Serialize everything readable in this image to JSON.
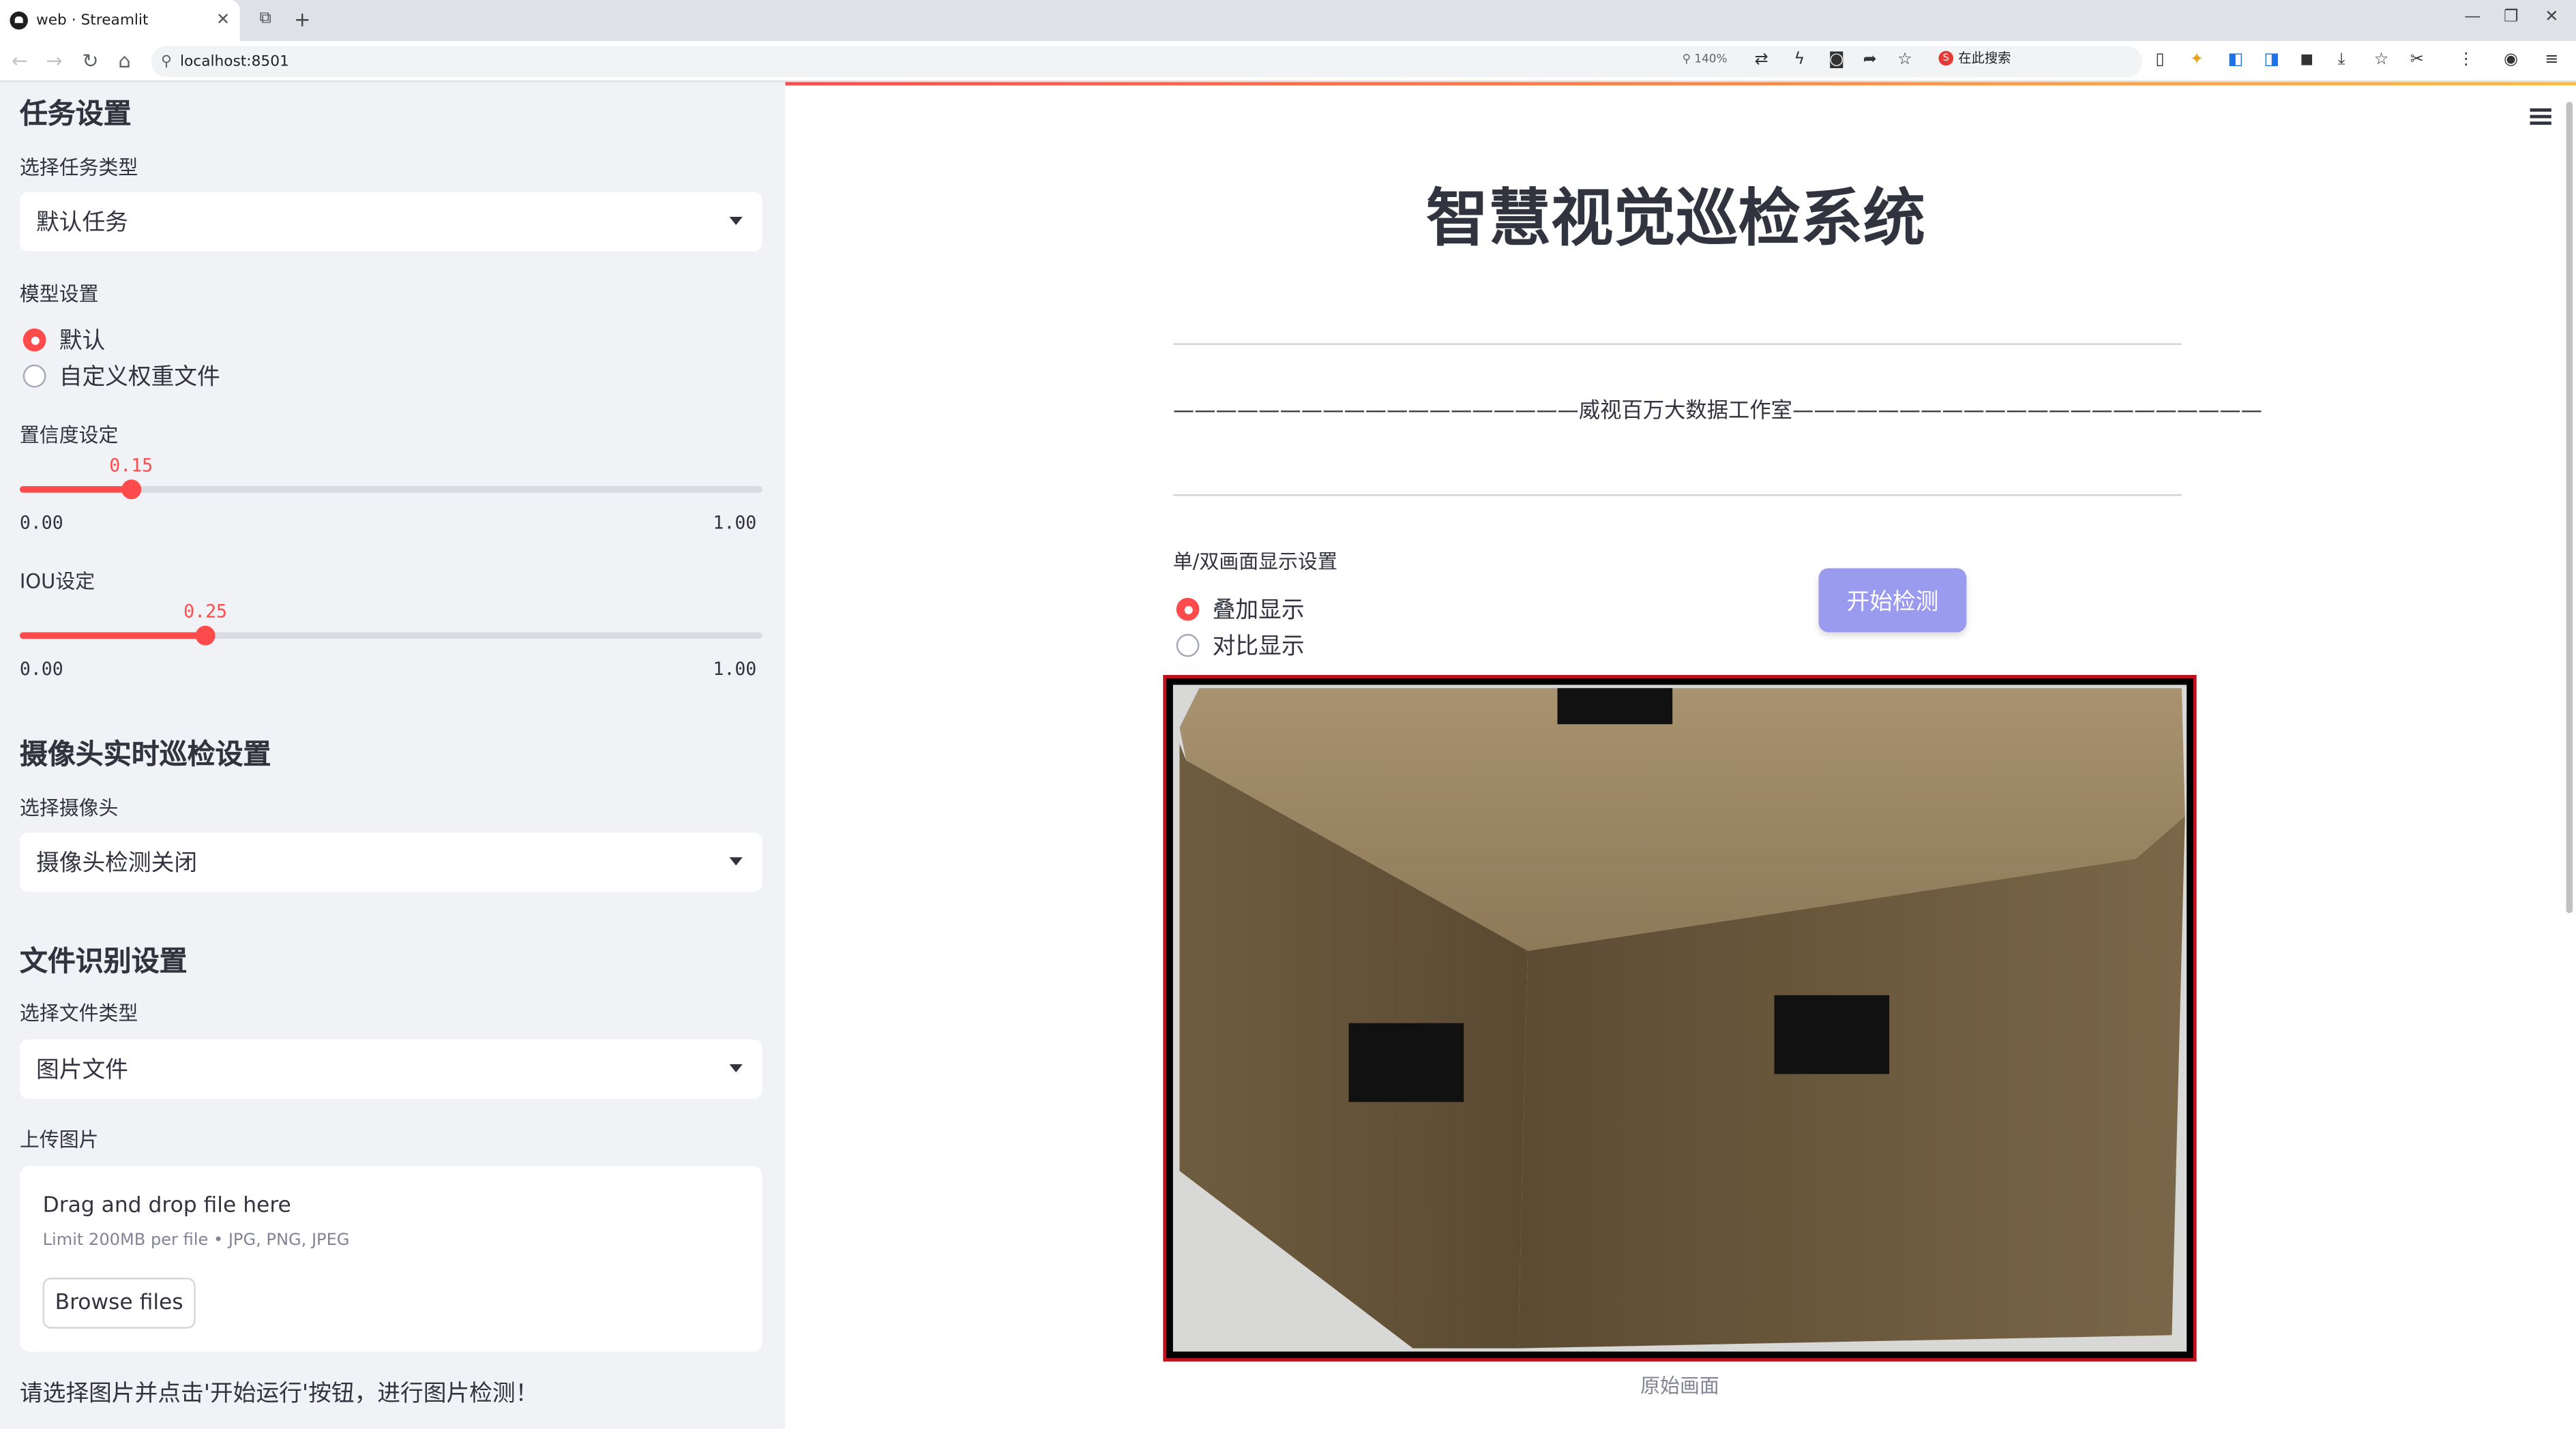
{
  "browser": {
    "tab_title": "web · Streamlit",
    "url": "localhost:8501",
    "zoom": "140%",
    "search_chip": "在此搜索"
  },
  "sidebar": {
    "task_section": {
      "heading": "任务设置",
      "select_label": "选择任务类型",
      "select_value": "默认任务"
    },
    "model": {
      "label": "模型设置",
      "options": [
        "默认",
        "自定义权重文件"
      ],
      "selected": "默认"
    },
    "confidence": {
      "label": "置信度设定",
      "value": "0.15",
      "fraction": 0.15,
      "min": "0.00",
      "max": "1.00"
    },
    "iou": {
      "label": "IOU设定",
      "value": "0.25",
      "fraction": 0.25,
      "min": "0.00",
      "max": "1.00"
    },
    "camera_section": {
      "heading": "摄像头实时巡检设置",
      "select_label": "选择摄像头",
      "select_value": "摄像头检测关闭"
    },
    "file_section": {
      "heading": "文件识别设置",
      "select_label": "选择文件类型",
      "select_value": "图片文件",
      "upload_label": "上传图片"
    },
    "uploader": {
      "title": "Drag and drop file here",
      "limit": "Limit 200MB per file • JPG, PNG, JPEG",
      "browse_label": "Browse files"
    },
    "hint": "请选择图片并点击'开始运行'按钮，进行图片检测！"
  },
  "main": {
    "title": "智慧视觉巡检系统",
    "studio_line": "———————————————————威视百万大数据工作室——————————————————————",
    "display_label": "单/双画面显示设置",
    "display_options": [
      "叠加显示",
      "对比显示"
    ],
    "display_selected": "叠加显示",
    "start_button": "开始检测",
    "image_caption": "原始画面"
  },
  "colors": {
    "accent": "#ff4b4b",
    "sidebar_bg": "#f0f2f6",
    "button_bg": "#9a9aef",
    "frame_border": "#c2101c"
  }
}
